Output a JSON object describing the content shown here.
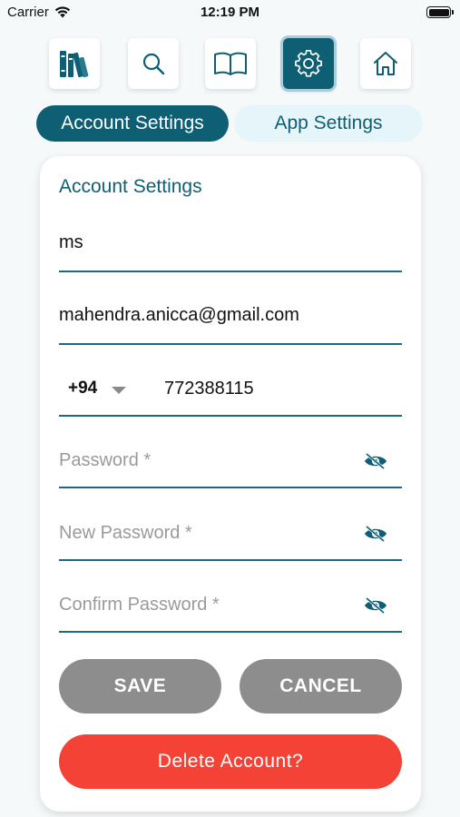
{
  "status_bar": {
    "carrier": "Carrier",
    "time": "12:19 PM"
  },
  "nav": {
    "items": [
      {
        "icon": "books-icon",
        "active": false
      },
      {
        "icon": "search-icon",
        "active": false
      },
      {
        "icon": "open-book-icon",
        "active": false
      },
      {
        "icon": "gear-icon",
        "active": true
      },
      {
        "icon": "home-icon",
        "active": false
      }
    ]
  },
  "tabs": {
    "account": "Account Settings",
    "app": "App Settings",
    "selected": "account"
  },
  "form": {
    "title": "Account Settings",
    "name_value": "ms",
    "email_value": "mahendra.anicca@gmail.com",
    "country_code": "+94",
    "phone_value": "772388115",
    "password_placeholder": "Password *",
    "new_password_placeholder": "New Password *",
    "confirm_password_placeholder": "Confirm Password *"
  },
  "buttons": {
    "save": "SAVE",
    "cancel": "CANCEL",
    "delete": "Delete Account?"
  },
  "colors": {
    "accent": "#0f5f74",
    "tab_inactive_bg": "#e6f5fa",
    "button_gray": "#8d8d8d",
    "danger": "#f44336"
  }
}
